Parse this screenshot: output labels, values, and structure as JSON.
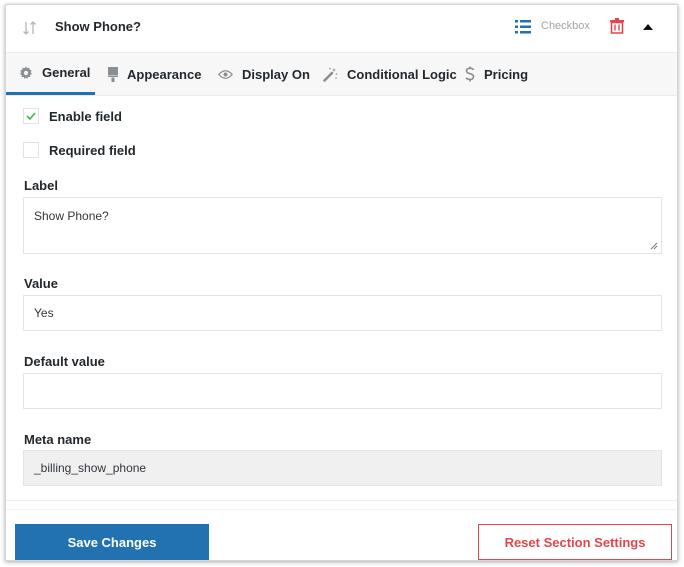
{
  "header": {
    "title": "Show Phone?",
    "field_type": "Checkbox",
    "icons": [
      "sort-arrows-icon",
      "list-icon",
      "trash-icon",
      "caret-up-icon"
    ]
  },
  "tabs": [
    {
      "label": "General",
      "icon": "gear-icon",
      "active": true
    },
    {
      "label": "Appearance",
      "icon": "paint-brush-icon",
      "active": false
    },
    {
      "label": "Display On",
      "icon": "eye-icon",
      "active": false
    },
    {
      "label": "Conditional Logic",
      "icon": "magic-wand-icon",
      "active": false
    },
    {
      "label": "Pricing",
      "icon": "dollar-icon",
      "active": false
    }
  ],
  "general": {
    "enable_field": {
      "label": "Enable field",
      "checked": true
    },
    "required_field": {
      "label": "Required field",
      "checked": false
    },
    "label": {
      "label": "Label",
      "value": "Show Phone?"
    },
    "value": {
      "label": "Value",
      "value": "Yes"
    },
    "default_value": {
      "label": "Default value",
      "value": ""
    },
    "meta_name": {
      "label": "Meta name",
      "value": "_billing_show_phone"
    }
  },
  "actions": {
    "save_label": "Save Changes",
    "reset_label": "Reset Section Settings"
  },
  "colors": {
    "primary": "#2271b1",
    "danger": "#e0474c",
    "check": "#46b450"
  }
}
